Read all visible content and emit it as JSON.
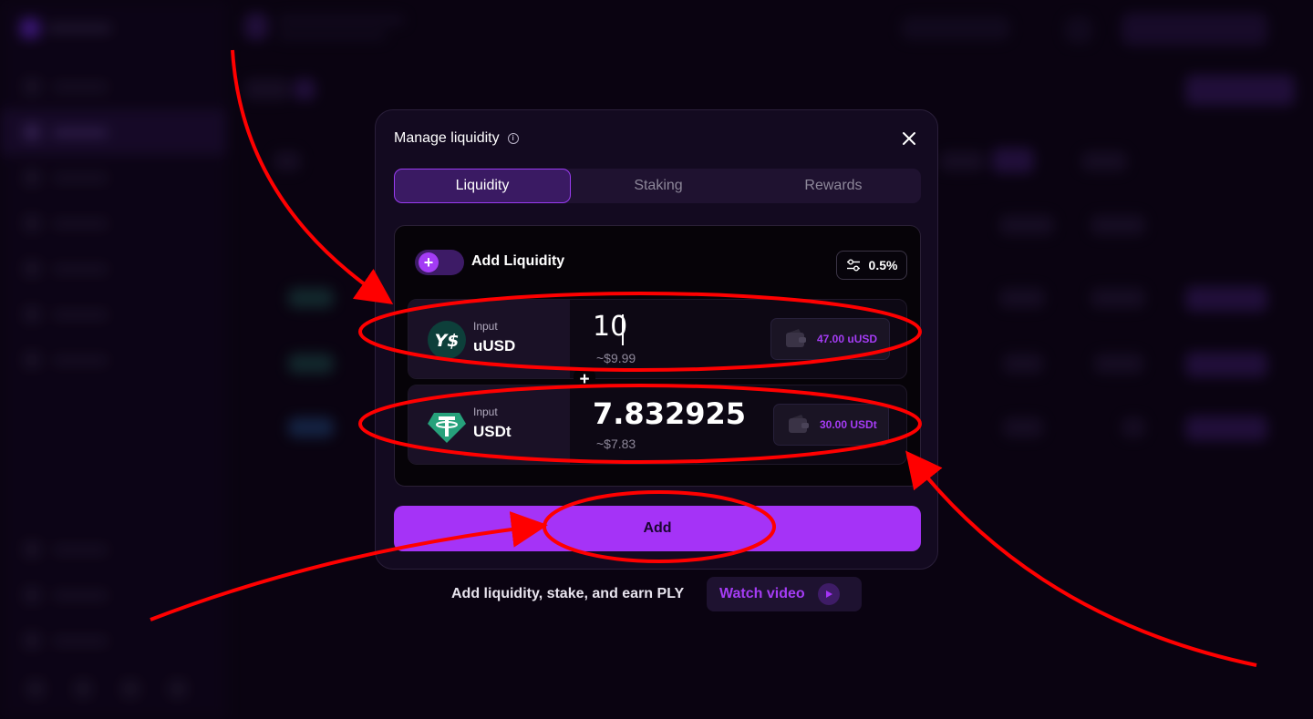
{
  "modal": {
    "title": "Manage liquidity",
    "tabs": [
      {
        "label": "Liquidity",
        "active": true
      },
      {
        "label": "Staking",
        "active": false
      },
      {
        "label": "Rewards",
        "active": false
      }
    ],
    "mode_label": "Add Liquidity",
    "toggle_icon": "plus-icon",
    "slippage": "0.5%",
    "tokens": [
      {
        "caption": "Input",
        "symbol": "uUSD",
        "amount": "10",
        "usd_value": "~$9.99",
        "balance": "47.00 uUSD"
      },
      {
        "caption": "Input",
        "symbol": "USDt",
        "amount": "7.832925",
        "usd_value": "~$7.83",
        "balance": "30.00 USDt"
      }
    ],
    "add_button": "Add"
  },
  "footer": {
    "text": "Add liquidity, stake, and earn PLY",
    "watch_label": "Watch video"
  },
  "colors": {
    "accent": "#a533f7",
    "background": "#0d0516",
    "annotation": "#ff0000"
  }
}
